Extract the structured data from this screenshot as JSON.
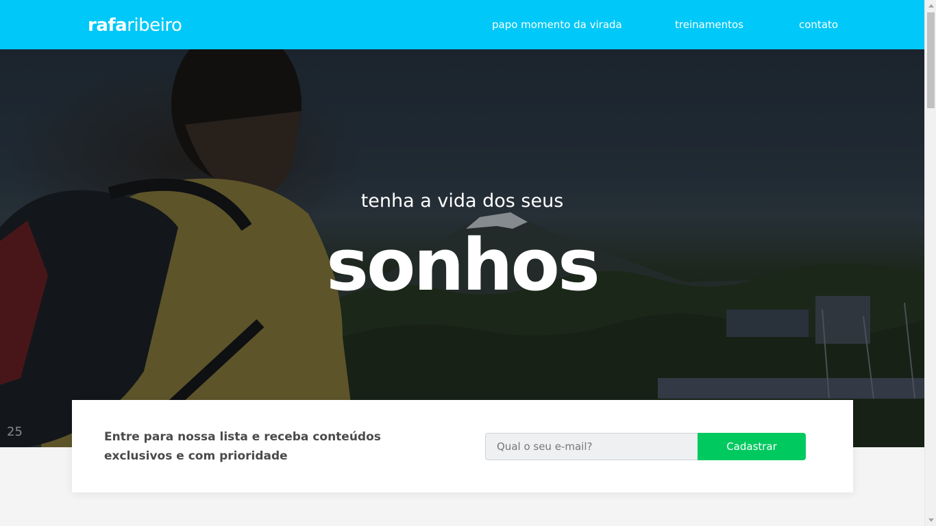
{
  "header": {
    "logo_bold": "rafa",
    "logo_light": "ribeiro",
    "nav": [
      {
        "label": "papo momento da virada"
      },
      {
        "label": "treinamentos"
      },
      {
        "label": "contato"
      }
    ]
  },
  "hero": {
    "subtitle": "tenha a vida dos seus",
    "title": "sonhos",
    "image_corner_text": "25"
  },
  "newsletter": {
    "text": "Entre para nossa lista e receba conteúdos exclusivos e com prioridade",
    "email_placeholder": "Qual o seu e-mail?",
    "email_value": "",
    "button_label": "Cadastrar"
  },
  "colors": {
    "header_bg": "#00c8f8",
    "button_bg": "#00c95f",
    "page_bg": "#f4f4f4",
    "card_text": "#4a4a4a"
  },
  "icons": [
    "scroll-up-arrow-icon",
    "scroll-down-arrow-icon"
  ]
}
